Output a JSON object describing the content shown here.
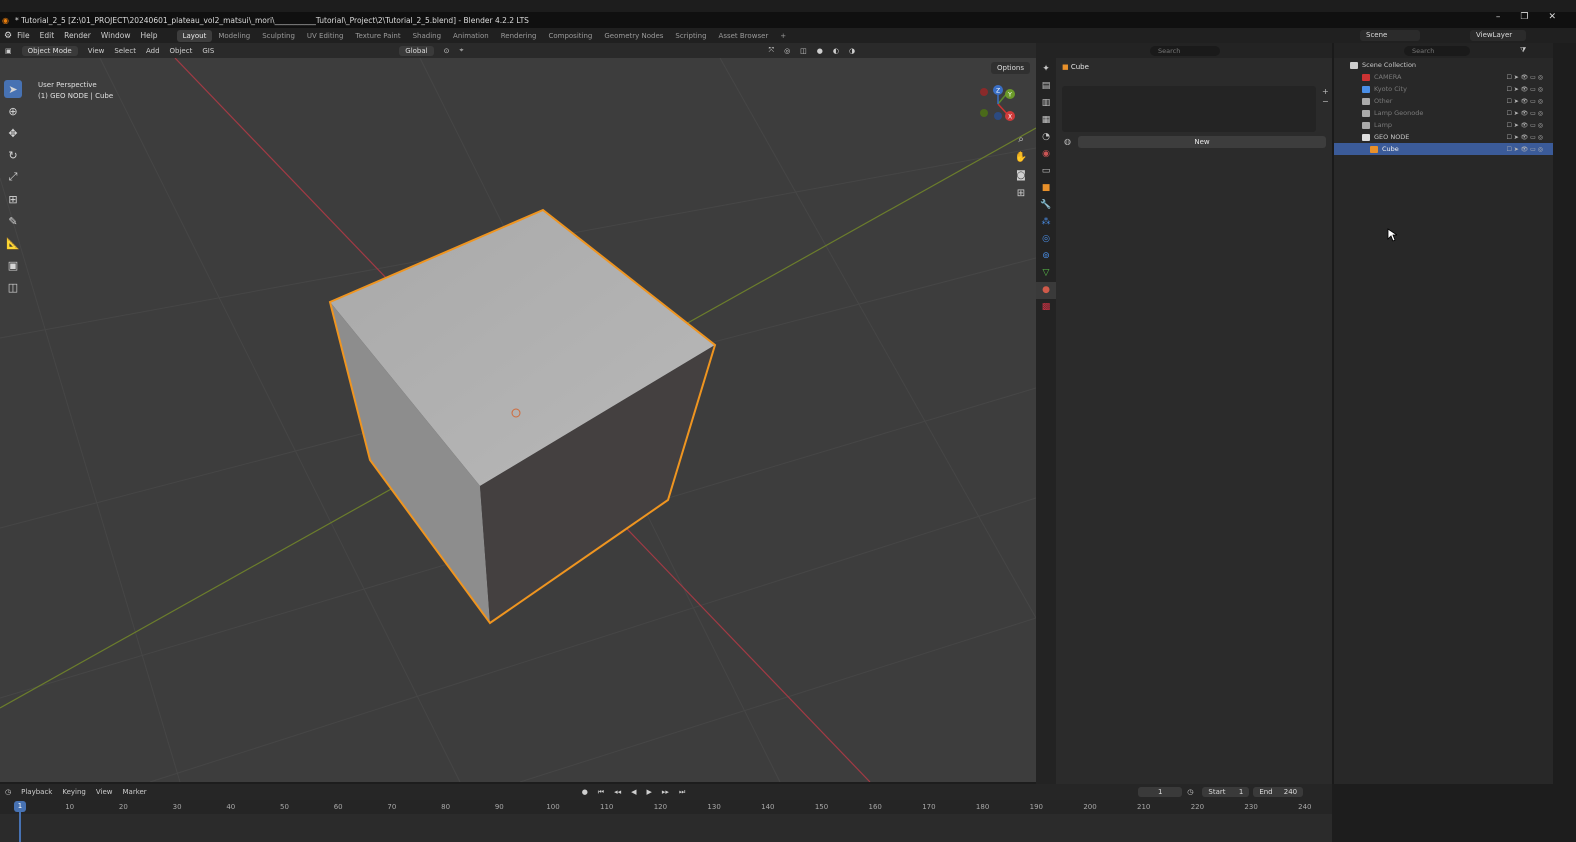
{
  "window": {
    "title": "* Tutorial_2_5 [Z:\\01_PROJECT\\20240601_plateau_vol2_matsui\\_mori\\___________Tutorial\\_Project\\2\\Tutorial_2_5.blend] - Blender 4.2.2 LTS",
    "minimize": "–",
    "maximize": "❐",
    "close": "✕"
  },
  "menu": [
    "File",
    "Edit",
    "Render",
    "Window",
    "Help"
  ],
  "workspaces": [
    {
      "label": "Layout",
      "active": true
    },
    {
      "label": "Modeling"
    },
    {
      "label": "Sculpting"
    },
    {
      "label": "UV Editing"
    },
    {
      "label": "Texture Paint"
    },
    {
      "label": "Shading"
    },
    {
      "label": "Animation"
    },
    {
      "label": "Rendering"
    },
    {
      "label": "Compositing"
    },
    {
      "label": "Geometry Nodes"
    },
    {
      "label": "Scripting"
    },
    {
      "label": "Asset Browser"
    },
    {
      "label": "+"
    }
  ],
  "scene": {
    "label": "Scene",
    "view_layer": "ViewLayer"
  },
  "viewport_header": {
    "mode": "Object Mode",
    "items": [
      "View",
      "Select",
      "Add",
      "Object"
    ],
    "gis": "GIS",
    "transform_orientation": "Global",
    "options": "Options"
  },
  "viewport": {
    "perspective": "User Perspective",
    "context": "(1) GEO NODE | Cube",
    "axis_x": "X",
    "axis_y": "Y",
    "axis_z": "Z"
  },
  "properties": {
    "search_placeholder": "Search",
    "object_name": "Cube",
    "new_button": "New"
  },
  "outliner": {
    "search_placeholder": "Search",
    "root": "Scene Collection",
    "items": [
      {
        "name": "CAMERA",
        "dim": true
      },
      {
        "name": "Kyoto City",
        "dim": true
      },
      {
        "name": "Other",
        "dim": true
      },
      {
        "name": "Lamp Geonode",
        "dim": true
      },
      {
        "name": "Lamp",
        "dim": true
      },
      {
        "name": "GEO NODE",
        "dim": false
      },
      {
        "name": "Cube",
        "selected": true
      }
    ]
  },
  "timeline": {
    "menu": [
      "Playback",
      "Keying",
      "View",
      "Marker"
    ],
    "current_frame": "1",
    "start_label": "Start",
    "start": "1",
    "end_label": "End",
    "end": "240",
    "ticks": [
      "10",
      "20",
      "30",
      "40",
      "50",
      "60",
      "70",
      "80",
      "90",
      "100",
      "110",
      "120",
      "130",
      "140",
      "150",
      "160",
      "170",
      "180",
      "190",
      "200",
      "210",
      "220",
      "230",
      "240"
    ]
  }
}
